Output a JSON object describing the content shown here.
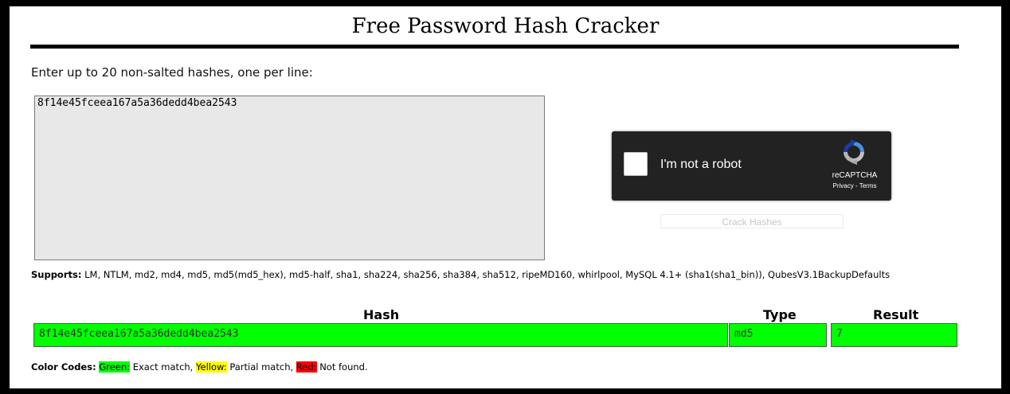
{
  "title": "Free Password Hash Cracker",
  "instructions": "Enter up to 20 non-salted hashes, one per line:",
  "hash_input": {
    "value": "8f14e45fceea167a5a36dedd4bea2543"
  },
  "captcha": {
    "label": "I'm not a robot",
    "brand": "reCAPTCHA",
    "links": "Privacy - Terms"
  },
  "crack_button": "Crack Hashes",
  "supports": {
    "label": "Supports:",
    "text": "LM, NTLM, md2, md4, md5, md5(md5_hex), md5-half, sha1, sha224, sha256, sha384, sha512, ripeMD160, whirlpool, MySQL 4.1+ (sha1(sha1_bin)), QubesV3.1BackupDefaults"
  },
  "results_table": {
    "headers": {
      "hash": "Hash",
      "type": "Type",
      "result": "Result"
    },
    "rows": [
      {
        "hash": "8f14e45fceea167a5a36dedd4bea2543",
        "type": "md5",
        "result": "7",
        "status_color": "#00ff00"
      }
    ]
  },
  "color_codes": {
    "label": "Color Codes:",
    "green": "Green:",
    "green_text": "Exact match,",
    "yellow": "Yellow:",
    "yellow_text": "Partial match,",
    "red": "Red:",
    "red_text": "Not found."
  },
  "colors": {
    "exact": "#00ff00",
    "partial": "#ffff00",
    "not_found": "#ff0000"
  }
}
